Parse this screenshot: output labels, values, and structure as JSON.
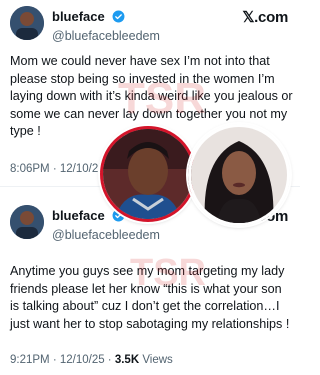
{
  "tweets": [
    {
      "name": "blueface",
      "handle": "@bluefacebleedem",
      "brand": "𝕏.com",
      "text": "Mom we could never have sex I’m not into that please stop being so invested in the women I’m laying down with it’s kinda weird like you jealous or some we can never lay down together you not my type !",
      "time": "8:06PM · 12/10/25"
    },
    {
      "name": "blueface",
      "handle": "@bluefacebleedem",
      "brand": "𝕏.com",
      "text": "Anytime you guys see my mom targeting my lady friends please let her know “this is what your son is talking about” cuz I don’t get the correlation…I just want her to stop sabotaging my relationships !",
      "time": "9:21PM · 12/10/25 · ",
      "views_count": "3.5K",
      "views_label": " Views"
    }
  ],
  "watermark": "TSR",
  "colors": {
    "verified": "#1d9bf0",
    "photo_ring": "#d4142a"
  }
}
